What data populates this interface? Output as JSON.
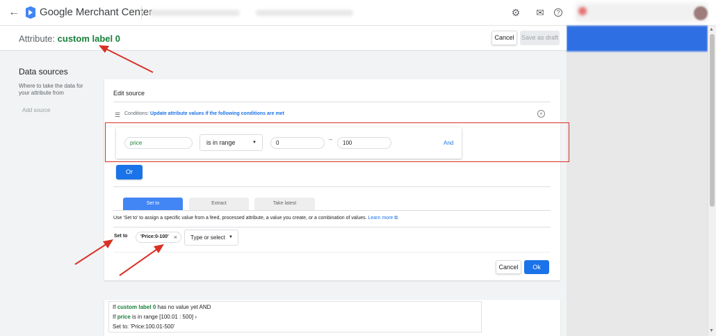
{
  "topbar": {
    "brand": "Google Merchant Center",
    "back_icon": "arrow-left-icon",
    "icons": [
      "gear-icon",
      "mail-icon",
      "help-icon"
    ]
  },
  "header": {
    "attr_prefix": "Attribute:",
    "attr_value": "custom label 0",
    "cancel": "Cancel",
    "save_draft": "Save as draft"
  },
  "data_sources": {
    "title": "Data sources",
    "description": "Where to take the data for your attribute from",
    "add_source": "Add source"
  },
  "editor": {
    "title": "Edit source",
    "conditions_prefix": "Conditions:",
    "conditions_text": "Update attribute values if the following conditions are met",
    "condition": {
      "attribute": "price",
      "operator": "is in range",
      "from": "0",
      "dash": "–",
      "to": "100",
      "and": "And"
    },
    "or": "Or",
    "tabs": [
      "Set to",
      "Extract",
      "Take latest"
    ],
    "help_text": "Use 'Set to' to assign a specific value from a feed, processed attribute, a value you create, or a combination of values.",
    "learn_more": "Learn more",
    "set_to_label": "Set to",
    "set_value": "'Price:0-100'",
    "type_select": "Type or select",
    "cancel": "Cancel",
    "ok": "Ok"
  },
  "summary": {
    "line1_prefix": "If",
    "line1_attr": "custom label 0",
    "line1_suffix": "has no value yet AND",
    "line2_prefix": "If",
    "line2_attr": "price",
    "line2_suffix": "is in range [100.01 : 500] ›",
    "line3": "Set to: 'Price:100.01-500'"
  },
  "colors": {
    "accent_blue": "#1a73e8",
    "label_green": "#188038",
    "annotation_red": "#d93025"
  }
}
